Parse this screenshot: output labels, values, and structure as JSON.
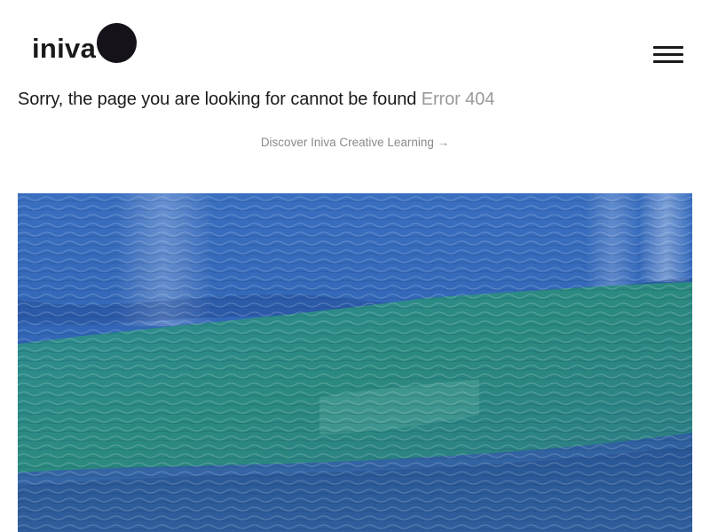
{
  "brand": {
    "logo_text": "iniva"
  },
  "header": {
    "menu_icon": "hamburger-menu-icon"
  },
  "error": {
    "message": "Sorry, the page you are looking for cannot be found",
    "code": "Error 404"
  },
  "link": {
    "text": "Discover Iniva Creative Learning",
    "arrow": "→"
  },
  "colors": {
    "logo_dot": "#15121a",
    "text": "#1a1a1a",
    "muted": "#9a9a9a",
    "water_blue": "#3d6fb7",
    "water_green": "#2e8c86"
  }
}
